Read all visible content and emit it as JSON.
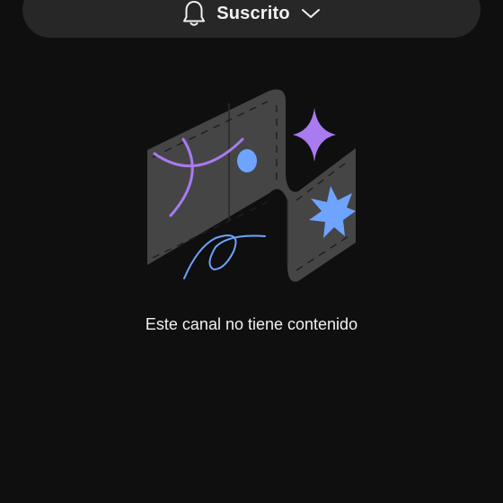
{
  "subscribe": {
    "label": "Suscrito",
    "bell_icon": "bell-icon",
    "chevron_icon": "chevron-down-icon"
  },
  "empty_state": {
    "message": "Este canal no tiene contenido",
    "illustration": "empty-channel-illustration"
  },
  "colors": {
    "background": "#0f0f0f",
    "bar": "#272727",
    "text": "#f1f1f1",
    "accent_purple": "#a97af0",
    "accent_blue": "#6ea3ff"
  }
}
